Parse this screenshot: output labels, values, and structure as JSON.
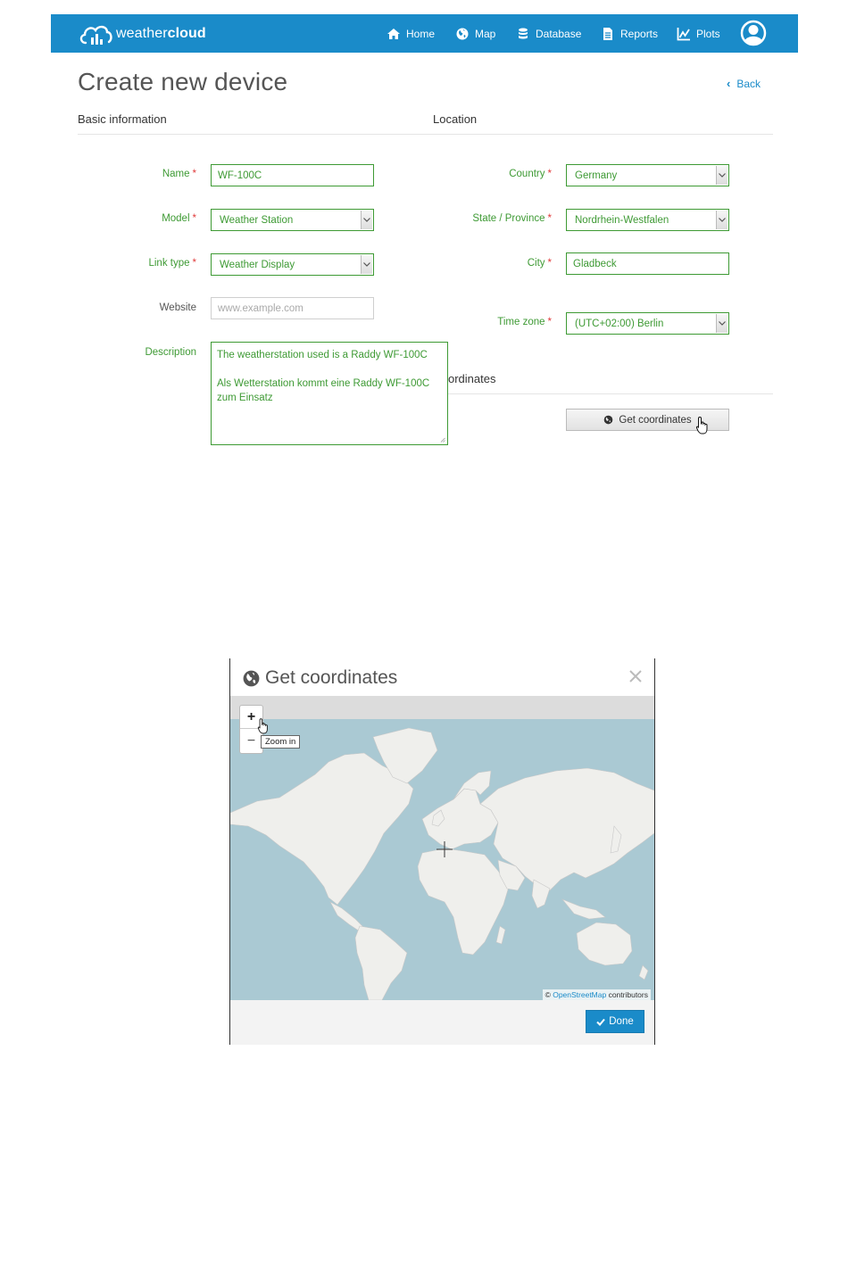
{
  "brand": {
    "name_light": "weather",
    "name_bold": "cloud"
  },
  "nav": [
    {
      "label": "Home",
      "icon": "home-icon"
    },
    {
      "label": "Map",
      "icon": "globe-icon"
    },
    {
      "label": "Database",
      "icon": "database-icon"
    },
    {
      "label": "Reports",
      "icon": "report-icon"
    },
    {
      "label": "Plots",
      "icon": "chart-line-icon"
    }
  ],
  "page": {
    "title": "Create new device",
    "back_label": "Back",
    "section_basic": "Basic information",
    "section_location": "Location",
    "section_coordinates_partial": "ordinates"
  },
  "form": {
    "name": {
      "label": "Name",
      "value": "WF-100C"
    },
    "model": {
      "label": "Model",
      "value": "Weather Station"
    },
    "link_type": {
      "label": "Link type",
      "value": "Weather Display"
    },
    "website": {
      "label": "Website",
      "placeholder": "www.example.com"
    },
    "description": {
      "label": "Description",
      "lines": [
        "The weatherstation used is a Raddy WF-100C",
        "",
        "Als Wetterstation kommt eine Raddy WF-100C",
        "zum Einsatz"
      ]
    },
    "country": {
      "label": "Country",
      "value": "Germany"
    },
    "state": {
      "label": "State / Province",
      "value": "Nordrhein-Westfalen"
    },
    "city": {
      "label": "City",
      "value": "Gladbeck"
    },
    "timezone": {
      "label": "Time zone",
      "value": "(UTC+02:00) Berlin"
    },
    "required_mark": "*",
    "get_coordinates_label": "Get coordinates"
  },
  "modal": {
    "title": "Get coordinates",
    "zoom_in": "+",
    "zoom_out": "−",
    "zoom_tooltip": "Zoom in",
    "attribution_prefix": "© ",
    "attribution_link": "OpenStreetMap",
    "attribution_suffix": " contributors",
    "done_label": "Done"
  },
  "colors": {
    "brand_blue": "#1a8bc9",
    "form_green": "#3e9a34",
    "required_red": "#e03a3a",
    "map_water": "#aac9d3",
    "map_land": "#efefec"
  }
}
